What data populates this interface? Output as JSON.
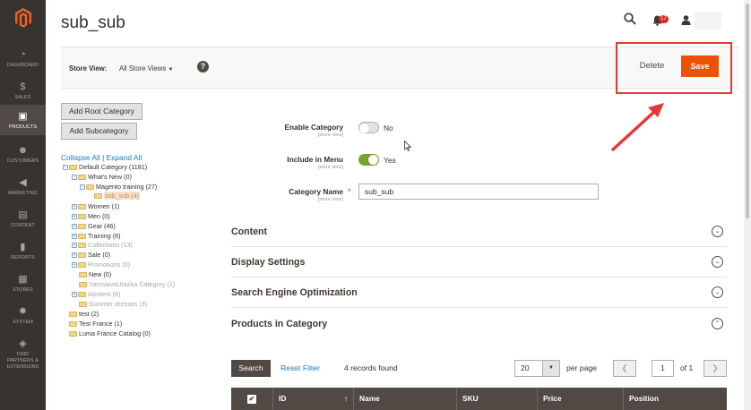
{
  "sidebar": {
    "items": [
      {
        "label": "DASHBOARD",
        "icon": "dashboard-icon",
        "glyph": "◔"
      },
      {
        "label": "SALES",
        "icon": "dollar-icon",
        "glyph": "$"
      },
      {
        "label": "PRODUCTS",
        "icon": "box-icon",
        "glyph": "▣",
        "active": true
      },
      {
        "label": "CUSTOMERS",
        "icon": "person-icon",
        "glyph": "☻"
      },
      {
        "label": "MARKETING",
        "icon": "megaphone-icon",
        "glyph": "◀"
      },
      {
        "label": "CONTENT",
        "icon": "layout-icon",
        "glyph": "▤"
      },
      {
        "label": "REPORTS",
        "icon": "bar-chart-icon",
        "glyph": "▮"
      },
      {
        "label": "STORES",
        "icon": "store-icon",
        "glyph": "▦"
      },
      {
        "label": "SYSTEM",
        "icon": "gear-icon",
        "glyph": "✹"
      },
      {
        "label": "FIND PARTNERS & EXTENSIONS",
        "icon": "cube-icon",
        "glyph": "◈"
      }
    ]
  },
  "header": {
    "title": "sub_sub",
    "notifications_count": "17"
  },
  "toolbar": {
    "store_view_label": "Store View:",
    "store_view_value": "All Store Views",
    "help_glyph": "?",
    "delete_label": "Delete",
    "save_label": "Save"
  },
  "tree_panel": {
    "add_root_label": "Add Root Category",
    "add_sub_label": "Add Subcategory",
    "collapse_all": "Collapse All",
    "separator": "|",
    "expand_all": "Expand All",
    "nodes": [
      "Default Category (1181)",
      "What's New (0)",
      "Magento training (27)",
      "sub_sub (4)",
      "Women (1)",
      "Men (0)",
      "Gear (46)",
      "Training (6)",
      "Collections (13)",
      "Sale (0)",
      "Promotions (0)",
      "New (0)",
      "YaroslavaUrazka Category (1)",
      "Alextest (8)",
      "Summer dresses (3)",
      "test (2)",
      "Test France (1)",
      "Luma France Catalog (0)"
    ]
  },
  "form": {
    "enable_label": "Enable Category",
    "enable_scope": "[store view]",
    "enable_value": "No",
    "menu_label": "Include in Menu",
    "menu_scope": "[store view]",
    "menu_value": "Yes",
    "name_label": "Category Name",
    "name_scope": "[store view]",
    "name_value": "sub_sub",
    "required_mark": "*"
  },
  "sections": [
    {
      "title": "Content",
      "chevron": "⌄"
    },
    {
      "title": "Display Settings",
      "chevron": "⌄"
    },
    {
      "title": "Search Engine Optimization",
      "chevron": "⌄"
    },
    {
      "title": "Products in Category",
      "chevron": "⌃"
    }
  ],
  "grid": {
    "search_label": "Search",
    "reset_label": "Reset Filter",
    "records_text": "4 records found",
    "per_page_value": "20",
    "per_page_label": "per page",
    "prev_glyph": "❮",
    "next_glyph": "❯",
    "page_value": "1",
    "page_of": "of 1",
    "columns": [
      "ID",
      "Name",
      "SKU",
      "Price",
      "Position"
    ],
    "sort_glyph": "↑",
    "check_glyph": "✔"
  },
  "colors": {
    "sidebar_bg": "#373330",
    "accent_orange": "#eb5202",
    "annotation_red": "#e53935",
    "toggle_on": "#79a22e",
    "link_blue": "#1979c3"
  }
}
